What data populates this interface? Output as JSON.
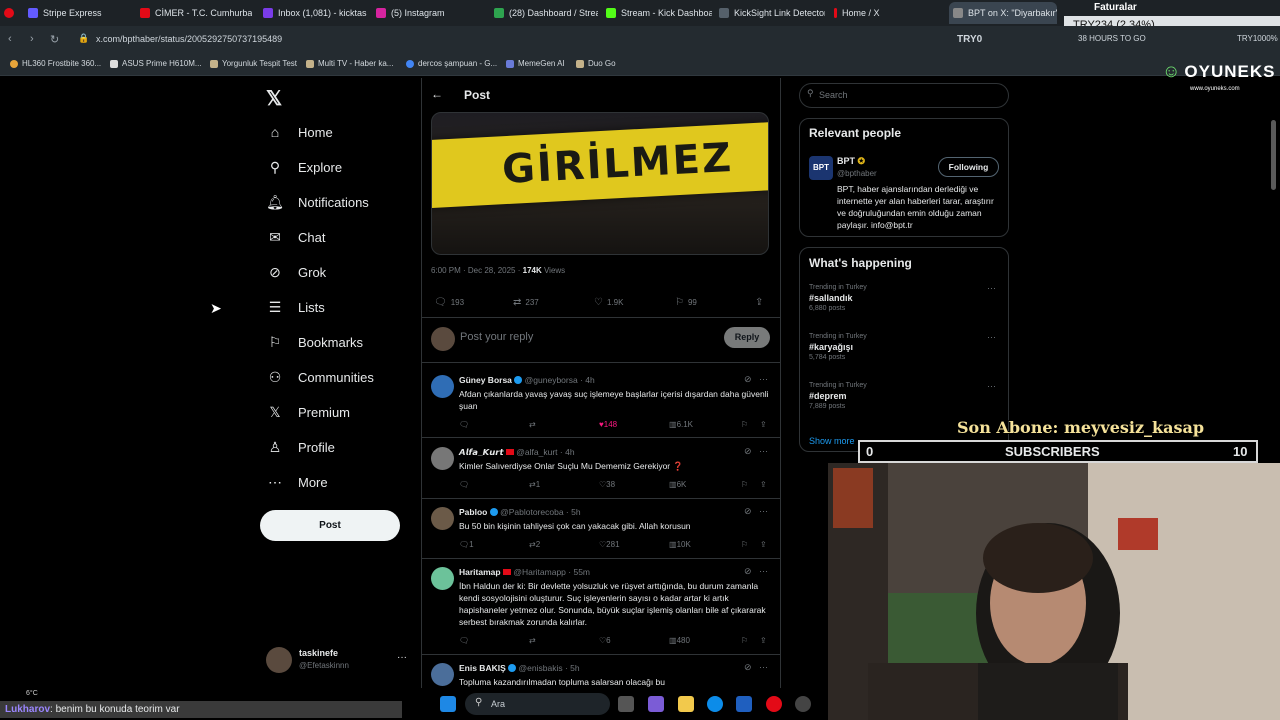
{
  "browser": {
    "tabs": [
      {
        "label": "Stripe Express",
        "color": "#635bff"
      },
      {
        "label": "CİMER - T.C. Cumhurbaşk...",
        "color": "#e30a17"
      },
      {
        "label": "Inbox (1,081) - kicktaskine...",
        "color": "#7a3ce8"
      },
      {
        "label": "(5) Instagram",
        "color": "#d6249f"
      },
      {
        "label": "(28) Dashboard / Streamla...",
        "color": "#2ea44f"
      },
      {
        "label": "Stream - Kick Dashboard",
        "color": "#53fc18"
      },
      {
        "label": "KickSight Link Detector",
        "color": "#1f2428"
      },
      {
        "label": "Home / X",
        "color": "#000000"
      },
      {
        "label": "BPT on X: \"Diyarbakır'da...",
        "color": "#000000"
      }
    ],
    "url": "x.com/bpthaber/status/2005292750737195489",
    "bookmarks": [
      {
        "label": "HL360 Frostbite 360..."
      },
      {
        "label": "ASUS Prime H610M..."
      },
      {
        "label": "Yorgunluk Tespit Test"
      },
      {
        "label": "Multi TV - Haber ka..."
      },
      {
        "label": "dercos şampuan - G..."
      },
      {
        "label": "MemeGen AI"
      },
      {
        "label": "Duo Go"
      }
    ],
    "ext_try": "TRY0",
    "ext_timer": "38 HOURS TO GO",
    "ext_try_right": "TRY1000%"
  },
  "ticker": {
    "title": "Faturalar",
    "value": "TRY234 (2.34%)"
  },
  "sidebar": {
    "items": [
      {
        "label": "Home",
        "icon": "home-icon"
      },
      {
        "label": "Explore",
        "icon": "search-icon"
      },
      {
        "label": "Notifications",
        "icon": "bell-icon"
      },
      {
        "label": "Chat",
        "icon": "mail-icon"
      },
      {
        "label": "Grok",
        "icon": "grok-icon"
      },
      {
        "label": "Lists",
        "icon": "list-icon"
      },
      {
        "label": "Bookmarks",
        "icon": "bookmark-icon"
      },
      {
        "label": "Communities",
        "icon": "people-icon"
      },
      {
        "label": "Premium",
        "icon": "x-icon"
      },
      {
        "label": "Profile",
        "icon": "person-icon"
      },
      {
        "label": "More",
        "icon": "more-icon"
      }
    ],
    "post_label": "Post",
    "account": {
      "name": "taskinefe",
      "handle": "@Efetaskinnn"
    }
  },
  "post": {
    "header": "Post",
    "media_text": "GİRİLMEZ",
    "time": "6:00 PM · Dec 28, 2025 ·",
    "views_count": "174K",
    "views_label": "Views",
    "stats": {
      "replies": "193",
      "reposts": "237",
      "likes": "1.9K",
      "bookmarks": "99"
    },
    "reply_placeholder": "Post your reply",
    "reply_button": "Reply"
  },
  "replies": [
    {
      "name": "Güney Borsa",
      "handle": "@guneyborsa",
      "time": "· 4h",
      "text": "Afdan çıkanlarda yavaş yavaş suç işlemeye başlarlar içerisi dışardan daha güvenli şuan",
      "replies": "",
      "reposts": "",
      "likes": "148",
      "views": "6.1K",
      "avatar_color": "#2f6db5",
      "liked": true
    },
    {
      "name": "𝘼𝙡𝙛𝙖_𝙆𝙪𝙧𝙩",
      "handle": "@alfa_kurt",
      "time": "· 4h",
      "text": "Kimler Salıverdiyse Onlar Suçlu Mu Dememiz Gerekiyor ❓",
      "replies": "",
      "reposts": "1",
      "likes": "38",
      "views": "6K",
      "avatar_color": "#777777",
      "liked": false
    },
    {
      "name": "Pabloo",
      "handle": "@Pablotorecoba",
      "time": "· 5h",
      "text": "Bu 50 bin kişinin tahliyesi çok can yakacak gibi. Allah korusun",
      "replies": "1",
      "reposts": "2",
      "likes": "281",
      "views": "10K",
      "avatar_color": "#6b5a48",
      "liked": false
    },
    {
      "name": "Haritamap",
      "handle": "@Haritamapp",
      "time": "· 55m",
      "text": "İbn Haldun der ki: Bir devlette yolsuzluk ve rüşvet arttığında, bu durum zamanla kendi sosyolojisini oluşturur. Suç işleyenlerin sayısı o kadar artar ki artık hapishaneler yetmez olur. Sonunda, büyük suçlar işlemiş olanları bile af çıkararak serbest bırakmak zorunda kalırlar.",
      "replies": "",
      "reposts": "",
      "likes": "6",
      "views": "480",
      "avatar_color": "#6cc29a",
      "liked": false
    },
    {
      "name": "Enis BAKIŞ",
      "handle": "@enisbakis",
      "time": "· 5h",
      "text": "Topluma kazandırılmadan topluma salarsan olacağı bu",
      "replies": "",
      "reposts": "",
      "likes": "",
      "views": "",
      "avatar_color": "#4b6e9a",
      "liked": false
    }
  ],
  "right": {
    "search_placeholder": "Search",
    "relevant_title": "Relevant people",
    "person": {
      "avatar_text": "BPT",
      "name": "BPT",
      "handle": "@bpthaber",
      "follow_label": "Following",
      "bio": "BPT, haber ajanslarından derlediği ve internette yer alan haberleri tarar, araştırır ve doğruluğundan emin olduğu zaman paylaşır. info@bpt.tr"
    },
    "happening_title": "What's happening",
    "trends": [
      {
        "context": "Trending in Turkey",
        "tag": "#sallandık",
        "count": "6,880 posts"
      },
      {
        "context": "Trending in Turkey",
        "tag": "#karyağışı",
        "count": "5,784 posts"
      },
      {
        "context": "Trending in Turkey",
        "tag": "#deprem",
        "count": "7,889 posts"
      }
    ],
    "show_more": "Show more"
  },
  "overlay": {
    "son_abone": "Son Abone: meyvesiz_kasap",
    "subs_left": "0",
    "subs_label": "SUBSCRIBERS",
    "subs_right": "10",
    "brand_name": "OYUNEKS",
    "brand_url": "www.oyuneks.com",
    "chat_user": "Lukharov",
    "chat_message": ": benim bu konuda teorim var"
  },
  "taskbar": {
    "search_label": "Ara",
    "weather": "6°C"
  },
  "colors": {
    "accent": "#1d9bf0",
    "like": "#f91880",
    "bg": "#000000",
    "border": "#2f3336"
  }
}
